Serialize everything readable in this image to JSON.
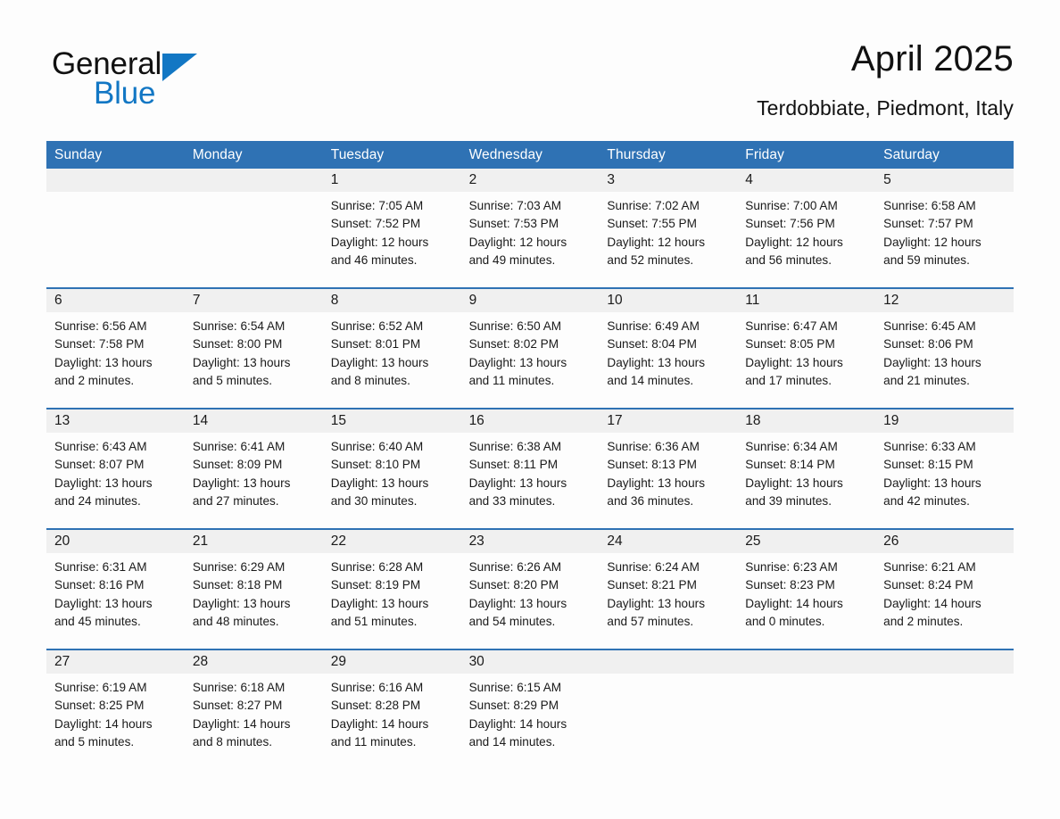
{
  "brand": {
    "name_part1": "General",
    "name_part2": "Blue",
    "accent_color": "#1277c4"
  },
  "header": {
    "title": "April 2025",
    "subtitle": "Terdobbiate, Piedmont, Italy",
    "header_bg_color": "#2f72b4",
    "day_band_color": "#f0f0f0"
  },
  "weekdays": [
    "Sunday",
    "Monday",
    "Tuesday",
    "Wednesday",
    "Thursday",
    "Friday",
    "Saturday"
  ],
  "weeks": [
    [
      {
        "day": "",
        "sunrise": "",
        "sunset": "",
        "daylight1": "",
        "daylight2": ""
      },
      {
        "day": "",
        "sunrise": "",
        "sunset": "",
        "daylight1": "",
        "daylight2": ""
      },
      {
        "day": "1",
        "sunrise": "Sunrise: 7:05 AM",
        "sunset": "Sunset: 7:52 PM",
        "daylight1": "Daylight: 12 hours",
        "daylight2": "and 46 minutes."
      },
      {
        "day": "2",
        "sunrise": "Sunrise: 7:03 AM",
        "sunset": "Sunset: 7:53 PM",
        "daylight1": "Daylight: 12 hours",
        "daylight2": "and 49 minutes."
      },
      {
        "day": "3",
        "sunrise": "Sunrise: 7:02 AM",
        "sunset": "Sunset: 7:55 PM",
        "daylight1": "Daylight: 12 hours",
        "daylight2": "and 52 minutes."
      },
      {
        "day": "4",
        "sunrise": "Sunrise: 7:00 AM",
        "sunset": "Sunset: 7:56 PM",
        "daylight1": "Daylight: 12 hours",
        "daylight2": "and 56 minutes."
      },
      {
        "day": "5",
        "sunrise": "Sunrise: 6:58 AM",
        "sunset": "Sunset: 7:57 PM",
        "daylight1": "Daylight: 12 hours",
        "daylight2": "and 59 minutes."
      }
    ],
    [
      {
        "day": "6",
        "sunrise": "Sunrise: 6:56 AM",
        "sunset": "Sunset: 7:58 PM",
        "daylight1": "Daylight: 13 hours",
        "daylight2": "and 2 minutes."
      },
      {
        "day": "7",
        "sunrise": "Sunrise: 6:54 AM",
        "sunset": "Sunset: 8:00 PM",
        "daylight1": "Daylight: 13 hours",
        "daylight2": "and 5 minutes."
      },
      {
        "day": "8",
        "sunrise": "Sunrise: 6:52 AM",
        "sunset": "Sunset: 8:01 PM",
        "daylight1": "Daylight: 13 hours",
        "daylight2": "and 8 minutes."
      },
      {
        "day": "9",
        "sunrise": "Sunrise: 6:50 AM",
        "sunset": "Sunset: 8:02 PM",
        "daylight1": "Daylight: 13 hours",
        "daylight2": "and 11 minutes."
      },
      {
        "day": "10",
        "sunrise": "Sunrise: 6:49 AM",
        "sunset": "Sunset: 8:04 PM",
        "daylight1": "Daylight: 13 hours",
        "daylight2": "and 14 minutes."
      },
      {
        "day": "11",
        "sunrise": "Sunrise: 6:47 AM",
        "sunset": "Sunset: 8:05 PM",
        "daylight1": "Daylight: 13 hours",
        "daylight2": "and 17 minutes."
      },
      {
        "day": "12",
        "sunrise": "Sunrise: 6:45 AM",
        "sunset": "Sunset: 8:06 PM",
        "daylight1": "Daylight: 13 hours",
        "daylight2": "and 21 minutes."
      }
    ],
    [
      {
        "day": "13",
        "sunrise": "Sunrise: 6:43 AM",
        "sunset": "Sunset: 8:07 PM",
        "daylight1": "Daylight: 13 hours",
        "daylight2": "and 24 minutes."
      },
      {
        "day": "14",
        "sunrise": "Sunrise: 6:41 AM",
        "sunset": "Sunset: 8:09 PM",
        "daylight1": "Daylight: 13 hours",
        "daylight2": "and 27 minutes."
      },
      {
        "day": "15",
        "sunrise": "Sunrise: 6:40 AM",
        "sunset": "Sunset: 8:10 PM",
        "daylight1": "Daylight: 13 hours",
        "daylight2": "and 30 minutes."
      },
      {
        "day": "16",
        "sunrise": "Sunrise: 6:38 AM",
        "sunset": "Sunset: 8:11 PM",
        "daylight1": "Daylight: 13 hours",
        "daylight2": "and 33 minutes."
      },
      {
        "day": "17",
        "sunrise": "Sunrise: 6:36 AM",
        "sunset": "Sunset: 8:13 PM",
        "daylight1": "Daylight: 13 hours",
        "daylight2": "and 36 minutes."
      },
      {
        "day": "18",
        "sunrise": "Sunrise: 6:34 AM",
        "sunset": "Sunset: 8:14 PM",
        "daylight1": "Daylight: 13 hours",
        "daylight2": "and 39 minutes."
      },
      {
        "day": "19",
        "sunrise": "Sunrise: 6:33 AM",
        "sunset": "Sunset: 8:15 PM",
        "daylight1": "Daylight: 13 hours",
        "daylight2": "and 42 minutes."
      }
    ],
    [
      {
        "day": "20",
        "sunrise": "Sunrise: 6:31 AM",
        "sunset": "Sunset: 8:16 PM",
        "daylight1": "Daylight: 13 hours",
        "daylight2": "and 45 minutes."
      },
      {
        "day": "21",
        "sunrise": "Sunrise: 6:29 AM",
        "sunset": "Sunset: 8:18 PM",
        "daylight1": "Daylight: 13 hours",
        "daylight2": "and 48 minutes."
      },
      {
        "day": "22",
        "sunrise": "Sunrise: 6:28 AM",
        "sunset": "Sunset: 8:19 PM",
        "daylight1": "Daylight: 13 hours",
        "daylight2": "and 51 minutes."
      },
      {
        "day": "23",
        "sunrise": "Sunrise: 6:26 AM",
        "sunset": "Sunset: 8:20 PM",
        "daylight1": "Daylight: 13 hours",
        "daylight2": "and 54 minutes."
      },
      {
        "day": "24",
        "sunrise": "Sunrise: 6:24 AM",
        "sunset": "Sunset: 8:21 PM",
        "daylight1": "Daylight: 13 hours",
        "daylight2": "and 57 minutes."
      },
      {
        "day": "25",
        "sunrise": "Sunrise: 6:23 AM",
        "sunset": "Sunset: 8:23 PM",
        "daylight1": "Daylight: 14 hours",
        "daylight2": "and 0 minutes."
      },
      {
        "day": "26",
        "sunrise": "Sunrise: 6:21 AM",
        "sunset": "Sunset: 8:24 PM",
        "daylight1": "Daylight: 14 hours",
        "daylight2": "and 2 minutes."
      }
    ],
    [
      {
        "day": "27",
        "sunrise": "Sunrise: 6:19 AM",
        "sunset": "Sunset: 8:25 PM",
        "daylight1": "Daylight: 14 hours",
        "daylight2": "and 5 minutes."
      },
      {
        "day": "28",
        "sunrise": "Sunrise: 6:18 AM",
        "sunset": "Sunset: 8:27 PM",
        "daylight1": "Daylight: 14 hours",
        "daylight2": "and 8 minutes."
      },
      {
        "day": "29",
        "sunrise": "Sunrise: 6:16 AM",
        "sunset": "Sunset: 8:28 PM",
        "daylight1": "Daylight: 14 hours",
        "daylight2": "and 11 minutes."
      },
      {
        "day": "30",
        "sunrise": "Sunrise: 6:15 AM",
        "sunset": "Sunset: 8:29 PM",
        "daylight1": "Daylight: 14 hours",
        "daylight2": "and 14 minutes."
      },
      {
        "day": "",
        "sunrise": "",
        "sunset": "",
        "daylight1": "",
        "daylight2": ""
      },
      {
        "day": "",
        "sunrise": "",
        "sunset": "",
        "daylight1": "",
        "daylight2": ""
      },
      {
        "day": "",
        "sunrise": "",
        "sunset": "",
        "daylight1": "",
        "daylight2": ""
      }
    ]
  ]
}
